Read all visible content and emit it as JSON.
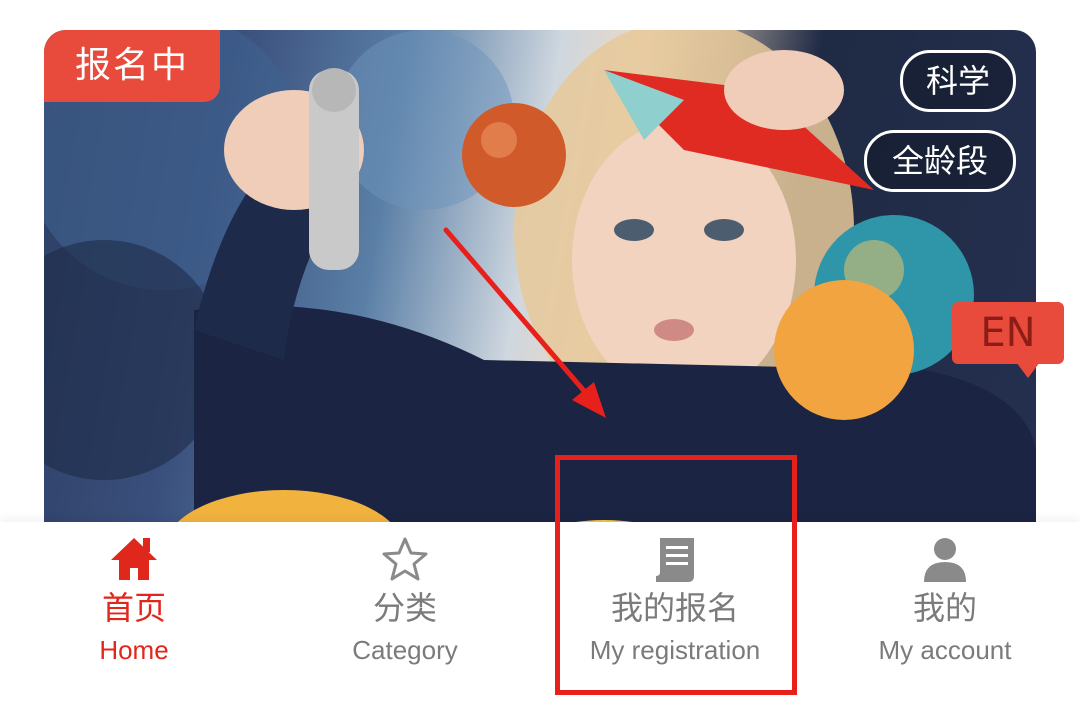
{
  "banner": {
    "status_badge": "报名中",
    "tags": [
      "科学",
      "全龄段"
    ],
    "language_toggle": "EN"
  },
  "tabbar": {
    "tabs": [
      {
        "icon": "home-icon",
        "label_zh": "首页",
        "label_en": "Home",
        "active": true
      },
      {
        "icon": "star-icon",
        "label_zh": "分类",
        "label_en": "Category",
        "active": false
      },
      {
        "icon": "document-icon",
        "label_zh": "我的报名",
        "label_en": "My registration",
        "active": false
      },
      {
        "icon": "user-icon",
        "label_zh": "我的",
        "label_en": "My account",
        "active": false
      }
    ]
  },
  "colors": {
    "accent": "#e0271c",
    "badge": "#e84a3c",
    "inactive": "#7b7b7b",
    "annotation": "#e8201b"
  }
}
